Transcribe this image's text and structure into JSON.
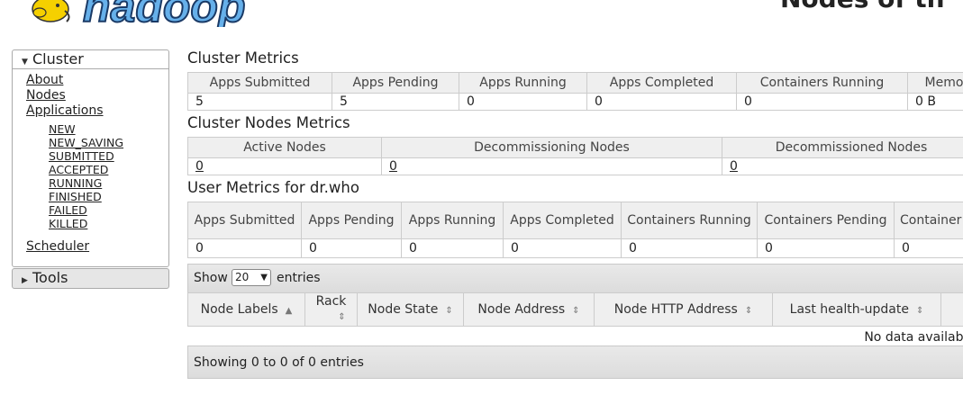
{
  "header": {
    "logo_text": "hadoop",
    "page_title": "Nodes of th"
  },
  "sidebar": {
    "cluster": {
      "label": "Cluster",
      "items": [
        "About",
        "Nodes",
        "Applications"
      ],
      "app_states": [
        "NEW",
        "NEW_SAVING",
        "SUBMITTED",
        "ACCEPTED",
        "RUNNING",
        "FINISHED",
        "FAILED",
        "KILLED"
      ],
      "scheduler": "Scheduler"
    },
    "tools": {
      "label": "Tools"
    }
  },
  "cluster_metrics": {
    "title": "Cluster Metrics",
    "headers": [
      "Apps Submitted",
      "Apps Pending",
      "Apps Running",
      "Apps Completed",
      "Containers Running",
      "Memo"
    ],
    "values": [
      "5",
      "5",
      "0",
      "0",
      "0",
      "0 B"
    ]
  },
  "cluster_nodes_metrics": {
    "title": "Cluster Nodes Metrics",
    "headers": [
      "Active Nodes",
      "Decommissioning Nodes",
      "Decommissioned Nodes"
    ],
    "values": [
      "0",
      "0",
      "0"
    ]
  },
  "user_metrics": {
    "title": "User Metrics for dr.who",
    "headers": [
      "Apps Submitted",
      "Apps Pending",
      "Apps Running",
      "Apps Completed",
      "Containers Running",
      "Containers Pending",
      "Container"
    ],
    "values": [
      "0",
      "0",
      "0",
      "0",
      "0",
      "0",
      "0"
    ]
  },
  "nodes_table": {
    "show_label": "Show",
    "entries_value": "20",
    "entries_label": "entries",
    "columns": [
      "Node Labels",
      "Rack",
      "Node State",
      "Node Address",
      "Node HTTP Address",
      "Last health-update"
    ],
    "empty_text": "No data availab",
    "info_text": "Showing 0 to 0 of 0 entries"
  }
}
